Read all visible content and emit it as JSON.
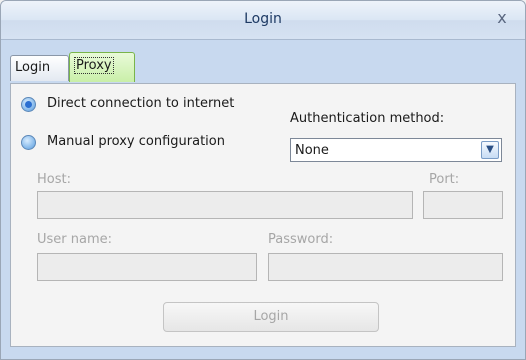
{
  "window": {
    "title": "Login",
    "close_glyph": "x"
  },
  "tabs": [
    {
      "label": "Login",
      "active": false
    },
    {
      "label": "Proxy",
      "active": true
    }
  ],
  "proxy": {
    "direct_label": "Direct connection to internet",
    "manual_label": "Manual proxy configuration",
    "selected": "direct",
    "auth_label": "Authentication method:",
    "auth_value": "None",
    "host_label": "Host:",
    "host_value": "",
    "port_label": "Port:",
    "port_value": "",
    "user_label": "User name:",
    "user_value": "",
    "password_label": "Password:",
    "password_value": "",
    "login_button": "Login"
  },
  "icons": {
    "dropdown": "chevron-down-icon",
    "close": "close-icon"
  }
}
